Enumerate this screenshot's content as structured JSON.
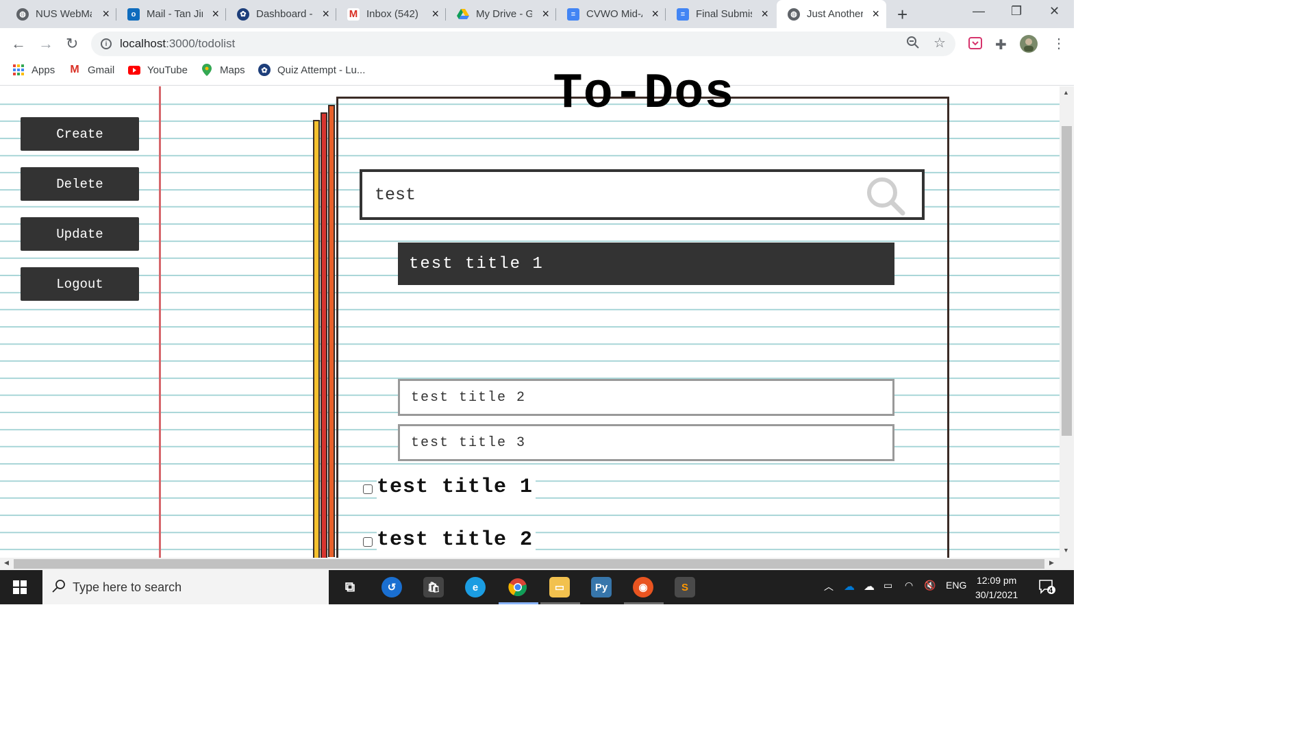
{
  "browser": {
    "tabs": [
      {
        "title": "NUS WebMail",
        "icon": "globe-icon"
      },
      {
        "title": "Mail - Tan Jin",
        "icon": "outlook-icon"
      },
      {
        "title": "Dashboard -",
        "icon": "dashboard-icon"
      },
      {
        "title": "Inbox (542)",
        "icon": "gmail-icon"
      },
      {
        "title": "My Drive - G",
        "icon": "drive-icon"
      },
      {
        "title": "CVWO Mid-A",
        "icon": "docs-icon"
      },
      {
        "title": "Final Submis",
        "icon": "docs-icon"
      },
      {
        "title": "Just Another",
        "icon": "globe-icon"
      }
    ],
    "url_host": "localhost",
    "url_path": ":3000/todolist",
    "bookmarks": [
      {
        "label": "Apps",
        "icon": "apps-grid-icon"
      },
      {
        "label": "Gmail",
        "icon": "gmail-icon"
      },
      {
        "label": "YouTube",
        "icon": "youtube-icon"
      },
      {
        "label": "Maps",
        "icon": "maps-pin-icon"
      },
      {
        "label": "Quiz Attempt - Lu...",
        "icon": "dashboard-icon"
      }
    ]
  },
  "sidebar": {
    "buttons": [
      {
        "label": "Create"
      },
      {
        "label": "Delete"
      },
      {
        "label": "Update"
      },
      {
        "label": "Logout"
      }
    ]
  },
  "main": {
    "title": "To-Dos",
    "search": {
      "value": "test"
    },
    "results": [
      {
        "title": "test title 1",
        "selected": true
      },
      {
        "title": "test title 2",
        "selected": false
      },
      {
        "title": "test title 3",
        "selected": false
      }
    ],
    "todos": [
      {
        "title": "test title 1",
        "checked": false
      },
      {
        "title": "test title 2",
        "checked": false
      }
    ]
  },
  "colors": {
    "button_dark": "#333333",
    "margin_line": "#d6666b",
    "ruled_line": "#a9d6d8",
    "spine_yellow": "#f5c12e",
    "spine_red": "#d8352f",
    "spine_orange": "#e8602a"
  },
  "taskbar": {
    "search_placeholder": "Type here to search",
    "language": "ENG",
    "time": "12:09 pm",
    "date": "30/1/2021",
    "notification_count": "4"
  }
}
